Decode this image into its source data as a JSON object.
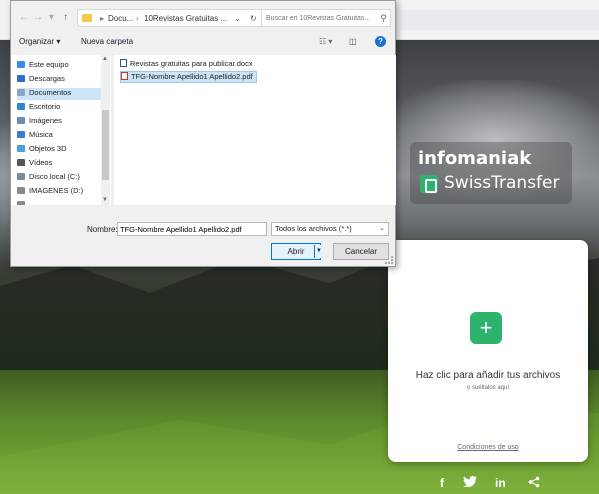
{
  "dialog": {
    "breadcrumb": [
      "Docu...",
      "10Revistas Gratuitas ..."
    ],
    "search_placeholder": "Buscar en 10Revistas Gratuitas...",
    "toolbar": {
      "organize": "Organizar ▾",
      "new_folder": "Nueva carpeta"
    },
    "nav_items": [
      {
        "label": "Este equipo",
        "icon": "pc-icon",
        "color": "#3a8ee6"
      },
      {
        "label": "Descargas",
        "icon": "download-icon",
        "color": "#2a6fc9"
      },
      {
        "label": "Documentos",
        "icon": "documents-icon",
        "color": "#8aa7c8",
        "selected": true
      },
      {
        "label": "Escritorio",
        "icon": "desktop-icon",
        "color": "#2f86d8"
      },
      {
        "label": "Imágenes",
        "icon": "images-icon",
        "color": "#6b8fb3"
      },
      {
        "label": "Música",
        "icon": "music-icon",
        "color": "#3a7bd5"
      },
      {
        "label": "Objetos 3D",
        "icon": "3d-icon",
        "color": "#4aa0e0"
      },
      {
        "label": "Vídeos",
        "icon": "video-icon",
        "color": "#555"
      },
      {
        "label": "Disco local (C:)",
        "icon": "disk-icon",
        "color": "#7a8b99"
      },
      {
        "label": "IMAGENES (D:)",
        "icon": "disk-icon",
        "color": "#8a8a8a"
      },
      {
        "label": "...",
        "icon": "disk-icon",
        "color": "#8a8a8a"
      }
    ],
    "files": [
      {
        "name": "Revistas gratuitas para publicar.docx",
        "icon": "docx-icon",
        "color": "#2b579a"
      },
      {
        "name": "TFG-Nombre Apellido1 Apellido2.pdf",
        "icon": "pdf-icon",
        "color": "#d93025",
        "selected": true
      }
    ],
    "filename_label": "Nombre:",
    "filename_value": "TFG-Nombre Apellido1 Apellido2.pdf",
    "filetype": "Todos los archivos (*.*)",
    "open_label": "Abrir",
    "cancel_label": "Cancelar"
  },
  "brand": {
    "name": "infomaniak",
    "product": "SwissTransfer"
  },
  "card": {
    "title": "Haz clic para añadir tus archivos",
    "subtitle": "o suéltalos aquí",
    "terms": "Condiciones de uso"
  },
  "social": [
    "f",
    "in"
  ],
  "colors": {
    "accent": "#2db36c",
    "selection": "#cce4f7"
  }
}
